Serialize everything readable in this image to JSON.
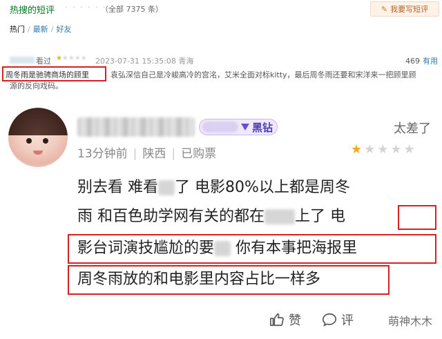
{
  "top": {
    "title": "热搜的短评",
    "dots": "· · · · · ·",
    "count": "（全部 7375 条）",
    "write_button": "我要写短评",
    "filters": [
      {
        "label": "热门",
        "active": true
      },
      {
        "label": "最新",
        "active": false
      },
      {
        "label": "好友",
        "active": false
      }
    ],
    "filter_sep": "/"
  },
  "short_review": {
    "status": "看过",
    "rating_stars": 1,
    "datetime": "2023-07-31 15:35:08 青海",
    "useful_count": "469",
    "useful_label": "有用",
    "highlight_text": "周冬雨是驰骋商场的顾里",
    "rest_text": "袁弘深信自己是冷峻高冷的宫洺，艾米全面对标kitty，最后周冬雨还要和宋洋来一把顾里顾",
    "line2": "源的反向戏码。"
  },
  "comment": {
    "badge_label": "黑钻",
    "verdict": "太差了",
    "time_ago": "13分钟前",
    "location": "陕西",
    "purchase": "已购票",
    "rating_stars": 1,
    "total_stars": 5,
    "line1_a": "别去看  难看",
    "line1_b": "了  电影80%以上都是周冬",
    "line2_a": "雨  和百色助学网有关的都在",
    "line2_b": "上了 ",
    "line2_c": "电",
    "line3_a": "影台词演技尴尬的要",
    "line3_b": "  你有本事把海报里",
    "line4": "周冬雨放的和电影里内容占比一样多",
    "like_label": "赞",
    "reply_label": "评",
    "watermark": "萌神木木"
  },
  "colors": {
    "douban_green": "#007722",
    "link_blue": "#3377aa",
    "highlight_red": "#d52020",
    "star_yellow": "#f5a623",
    "badge_purple": "#4b3cb5"
  }
}
